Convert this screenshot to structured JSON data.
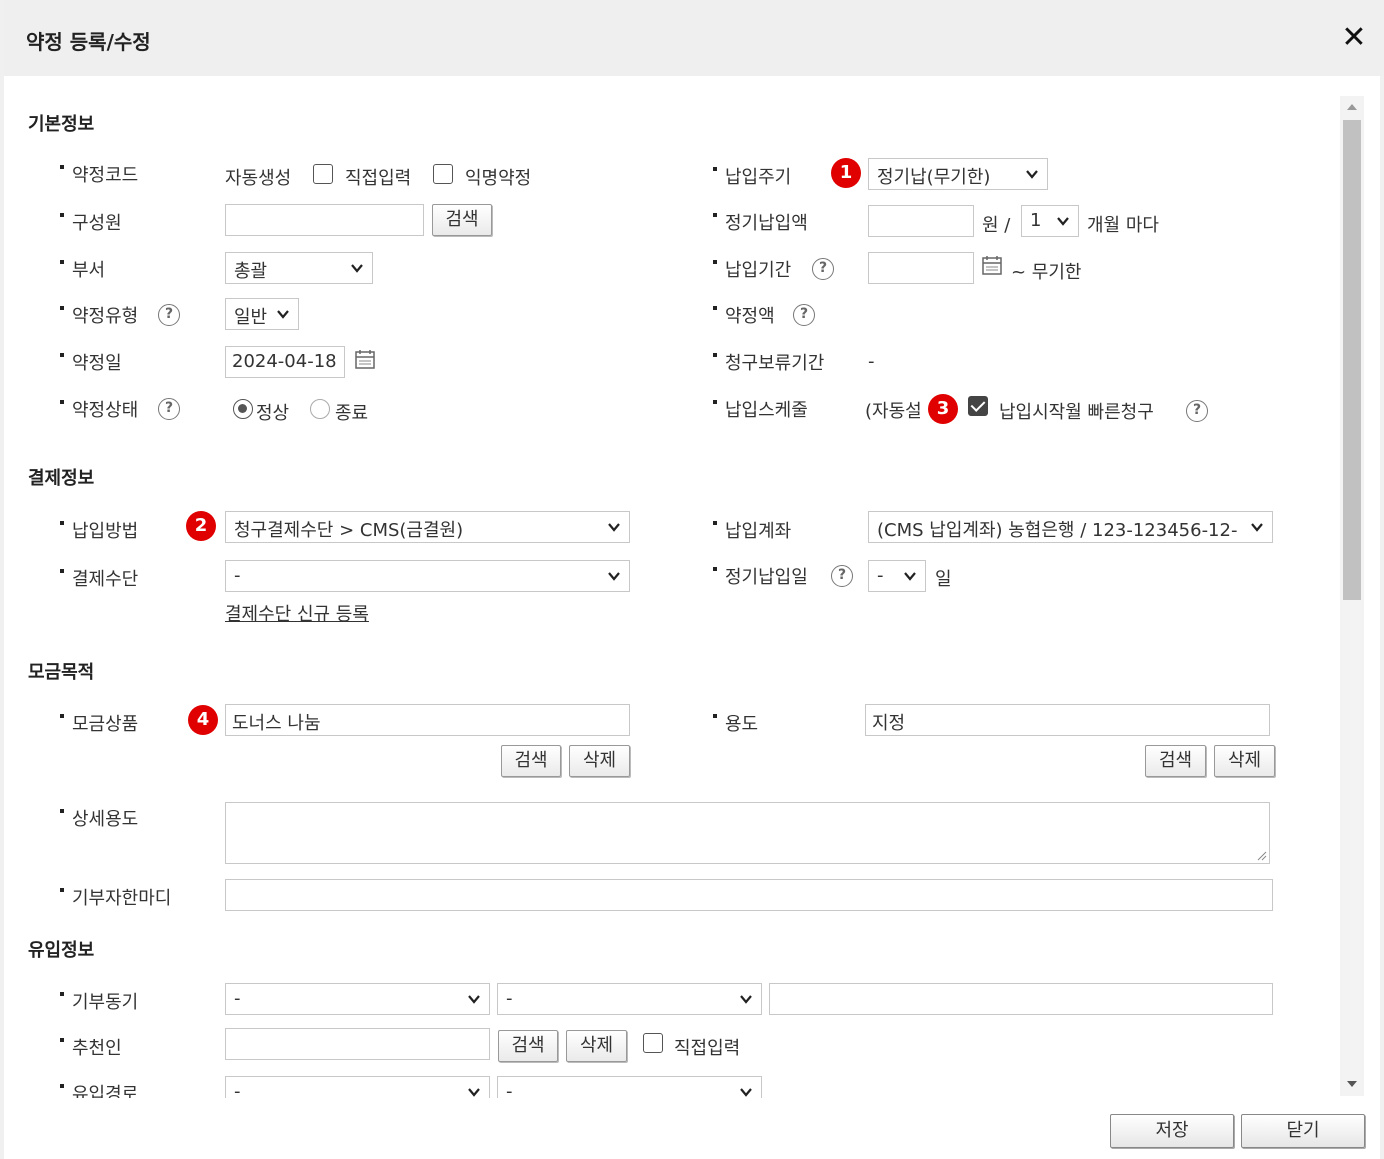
{
  "dialog": {
    "title": "약정 등록/수정",
    "close_icon": "✕"
  },
  "sections": {
    "basic": "기본정보",
    "payment": "결제정보",
    "purpose": "모금목적",
    "inflow": "유입정보"
  },
  "basic": {
    "code_label": "약정코드",
    "code_auto": "자동생성",
    "code_direct": "직접입력",
    "code_anon": "익명약정",
    "member_label": "구성원",
    "member_value": "",
    "member_search": "검색",
    "dept_label": "부서",
    "dept_value": "총괄",
    "type_label": "약정유형",
    "type_value": "일반",
    "date_label": "약정일",
    "date_value": "2024-04-18",
    "status_label": "약정상태",
    "status_normal": "정상",
    "status_end": "종료",
    "cycle_label": "납입주기",
    "cycle_value": "정기납(무기한)",
    "amount_label": "정기납입액",
    "amount_value": "",
    "amount_unit": "원 /",
    "months_value": "1",
    "months_unit": "개월 마다",
    "period_label": "납입기간",
    "period_start": "",
    "period_end": "~ 무기한",
    "total_label": "약정액",
    "hold_label": "청구보류기간",
    "hold_value": "-",
    "schedule_label": "납입스케줄",
    "schedule_value": "(자동설",
    "fast_label": "납입시작월 빠른청구"
  },
  "payment": {
    "method_label": "납입방법",
    "method_value": "청구결제수단 > CMS(금결원)",
    "means_label": "결제수단",
    "means_value": "-",
    "means_new_link": "결제수단 신규 등록",
    "account_label": "납입계좌",
    "account_value": "(CMS 납입계좌) 농협은행 / 123-123456-12-",
    "day_label": "정기납입일",
    "day_value": "-",
    "day_unit": "일"
  },
  "purpose": {
    "product_label": "모금상품",
    "product_value": "도너스 나눔",
    "usage_label": "용도",
    "usage_value": "지정",
    "search": "검색",
    "delete": "삭제",
    "detail_label": "상세용도",
    "comment_label": "기부자한마디"
  },
  "inflow": {
    "motive_label": "기부동기",
    "motive_1": "-",
    "motive_2": "-",
    "motive_text": "",
    "recommender_label": "추천인",
    "recommender_search": "검색",
    "recommender_delete": "삭제",
    "recommender_direct": "직접입력",
    "route_label": "유입경로",
    "route_1": "-",
    "route_2": "-"
  },
  "badges": [
    "1",
    "2",
    "3",
    "4"
  ],
  "footer": {
    "save": "저장",
    "close": "닫기"
  },
  "icons": {
    "help": "?",
    "calendar": "calendar-icon",
    "chevron": "chevron-down-icon"
  },
  "colors": {
    "badge": "#e00000",
    "titlebar": "#efefef"
  }
}
